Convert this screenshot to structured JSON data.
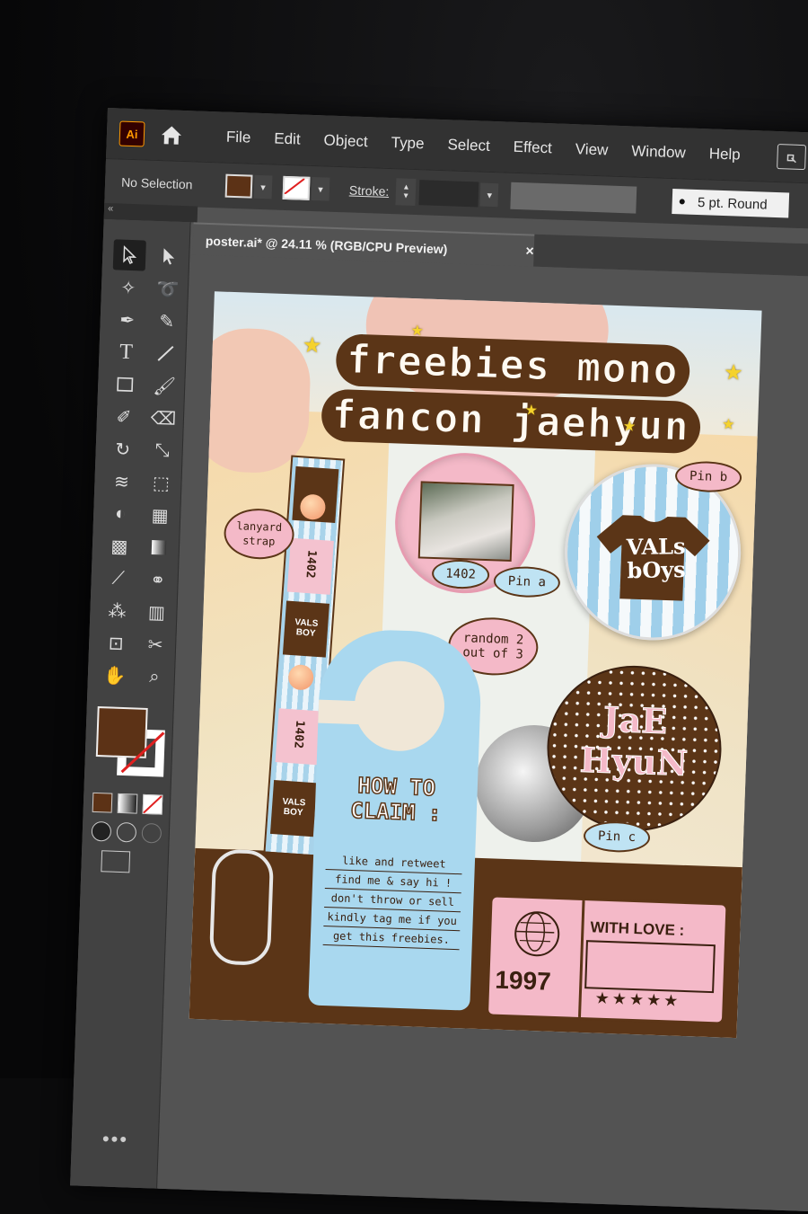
{
  "app": {
    "logo": "Ai",
    "menus": [
      "File",
      "Edit",
      "Object",
      "Type",
      "Select",
      "Effect",
      "View",
      "Window",
      "Help"
    ]
  },
  "control_bar": {
    "selection_status": "No Selection",
    "stroke_label": "Stroke:",
    "brush_label": "5 pt. Round",
    "fill_color": "#5c3216"
  },
  "panel_collapse": "«",
  "document": {
    "tab_title": "poster.ai* @ 24.11 % (RGB/CPU Preview)",
    "close_glyph": "×"
  },
  "poster": {
    "title_line1": "freebies mono",
    "title_line2": "fancon jaehyun",
    "labels": {
      "lanyard": "lanyard strap",
      "pin_a": "Pin a",
      "pin_b": "Pin b",
      "pin_c": "Pin c",
      "random": "random 2 out of 3",
      "pin_a_badge": "1402"
    },
    "lanyard_text": [
      "1402",
      "1402",
      "VALS BOY",
      "VALS BOY"
    ],
    "pin_b_text": "VALs bOys",
    "pin_c_text": "JaE HyuN",
    "how_to_claim": "HOW TO CLAIM :",
    "steps": [
      "like and retweet",
      "find me & say hi !",
      "don't throw or sell",
      "kindly tag me if you",
      "get this freebies."
    ],
    "ticket": {
      "year": "1997",
      "with_love": "WITH LOVE :",
      "stars": "★★★★★"
    },
    "colors": {
      "brown": "#5b3517",
      "pink": "#f4b9c8",
      "blue": "#a9d8ef",
      "star_yellow": "#f5d22c"
    }
  }
}
